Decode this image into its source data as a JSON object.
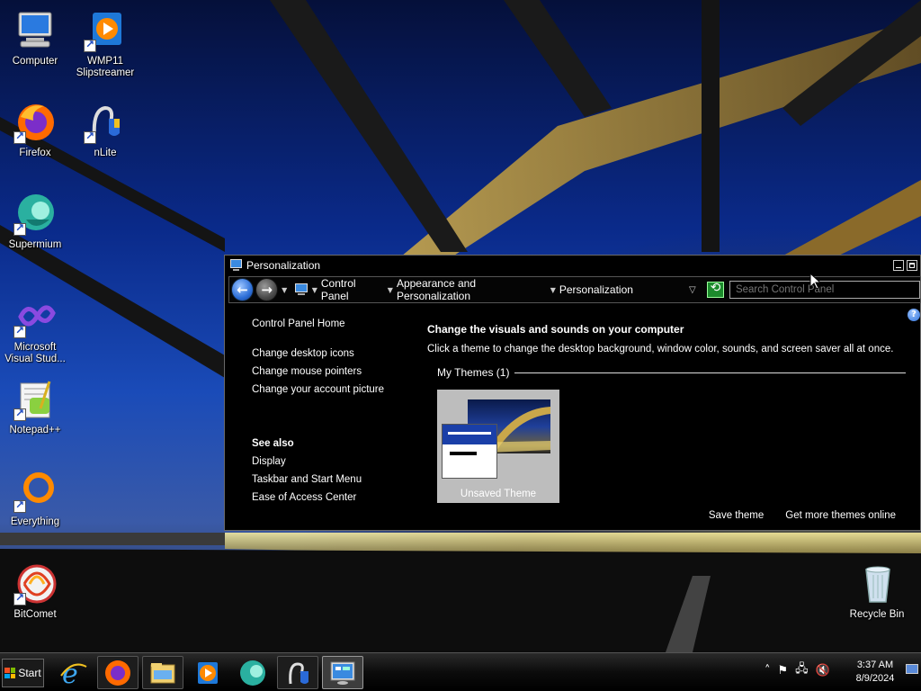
{
  "desktop": {
    "icons": [
      {
        "label": "Computer",
        "icon": "computer-icon"
      },
      {
        "label": "WMP11\nSlipstreamer",
        "icon": "wmp-slipstreamer-icon"
      },
      {
        "label": "Firefox",
        "icon": "firefox-icon"
      },
      {
        "label": "nLite",
        "icon": "nlite-icon"
      },
      {
        "label": "Supermium",
        "icon": "supermium-icon"
      },
      {
        "label": "Microsoft\nVisual Stud...",
        "icon": "visual-studio-icon"
      },
      {
        "label": "Notepad++",
        "icon": "notepadpp-icon"
      },
      {
        "label": "Everything",
        "icon": "everything-icon"
      },
      {
        "label": "BitComet",
        "icon": "bitcomet-icon"
      },
      {
        "label": "Recycle Bin",
        "icon": "recycle-bin-icon"
      }
    ]
  },
  "window": {
    "title": "Personalization",
    "breadcrumbs": [
      "Control Panel",
      "Appearance and Personalization",
      "Personalization"
    ],
    "search_placeholder": "Search Control Panel",
    "help": "?",
    "sidebar": {
      "home": "Control Panel Home",
      "links": [
        "Change desktop icons",
        "Change mouse pointers",
        "Change your account picture"
      ],
      "see_also_title": "See also",
      "see_also": [
        "Display",
        "Taskbar and Start Menu",
        "Ease of Access Center"
      ]
    },
    "main": {
      "heading": "Change the visuals and sounds on your computer",
      "description": "Click a theme to change the desktop background, window color, sounds, and screen saver all at once.",
      "group_title": "My Themes (1)",
      "theme_name": "Unsaved Theme"
    },
    "bottom_links": {
      "save": "Save theme",
      "more": "Get more themes online"
    }
  },
  "taskbar": {
    "start_label": "Start",
    "pinned": [
      "internet-explorer-icon",
      "firefox-icon",
      "explorer-icon",
      "media-player-icon",
      "supermium-icon",
      "nlite-icon",
      "control-panel-icon"
    ],
    "clock_time": "3:37 AM",
    "clock_date": "8/9/2024"
  },
  "colors": {
    "window_bg": "#000000",
    "accent_blue": "#2d6fd8",
    "taskbar": "#0c0c0c"
  }
}
